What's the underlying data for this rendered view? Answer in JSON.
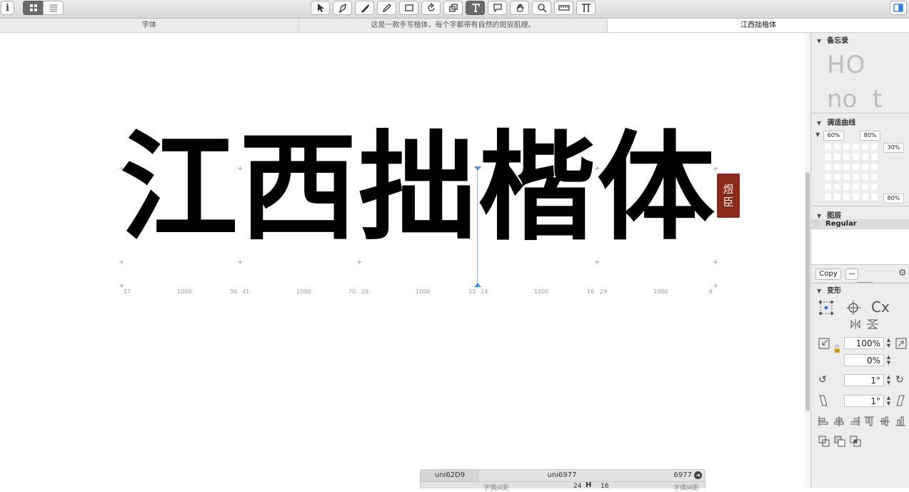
{
  "toolbar": {
    "info_label": "i",
    "tools": [
      "select-tool",
      "draw-tool",
      "pen-tool",
      "pencil-tool",
      "shape-tool",
      "rotate-tool",
      "scale-tool",
      "text-tool",
      "annotation-tool",
      "hand-tool",
      "zoom-tool",
      "measure-tool",
      "type-tool"
    ],
    "active_tool": "text-tool",
    "accent": "#2a7de1"
  },
  "tabs": [
    "字体",
    "这是一款手写楷体，每个字都带有自然的斑驳肌理。",
    "江西拙楷体"
  ],
  "canvas": {
    "glyphs": [
      "江",
      "西",
      "拙",
      "楷",
      "体"
    ],
    "metrics": [
      "17",
      "1000",
      "36",
      "41",
      "1000",
      "70",
      "29",
      "1000",
      "33",
      "24",
      "1000",
      "16",
      "29",
      "1000",
      "-9"
    ],
    "seal_text": [
      "煜",
      "臣"
    ],
    "seal_color": "#8b2b1c"
  },
  "bottom": {
    "left_name": "uni62D9",
    "center_name": "uni6977",
    "right_code": "6977",
    "sub_left": "字偶间距",
    "sub_num_left": "24",
    "sub_num_right": "16",
    "sub_right": "字偶间距"
  },
  "panel": {
    "memo_title": "备忘录",
    "memo_preview_line1": "HO",
    "memo_preview_line2": "no  t",
    "curve_title": "调适曲线",
    "curve_pct_left": "60%",
    "curve_pct_right": "80%",
    "curve_pct_side_top": "30%",
    "curve_pct_side_bottom": "80%",
    "layers_title": "图层",
    "layer_name": "Regular",
    "copy_label": "Copy",
    "transform_title": "变形",
    "scale_value": "100%",
    "scale_value2": "0%",
    "rotate_value": "1°",
    "slant_value": "1°"
  }
}
